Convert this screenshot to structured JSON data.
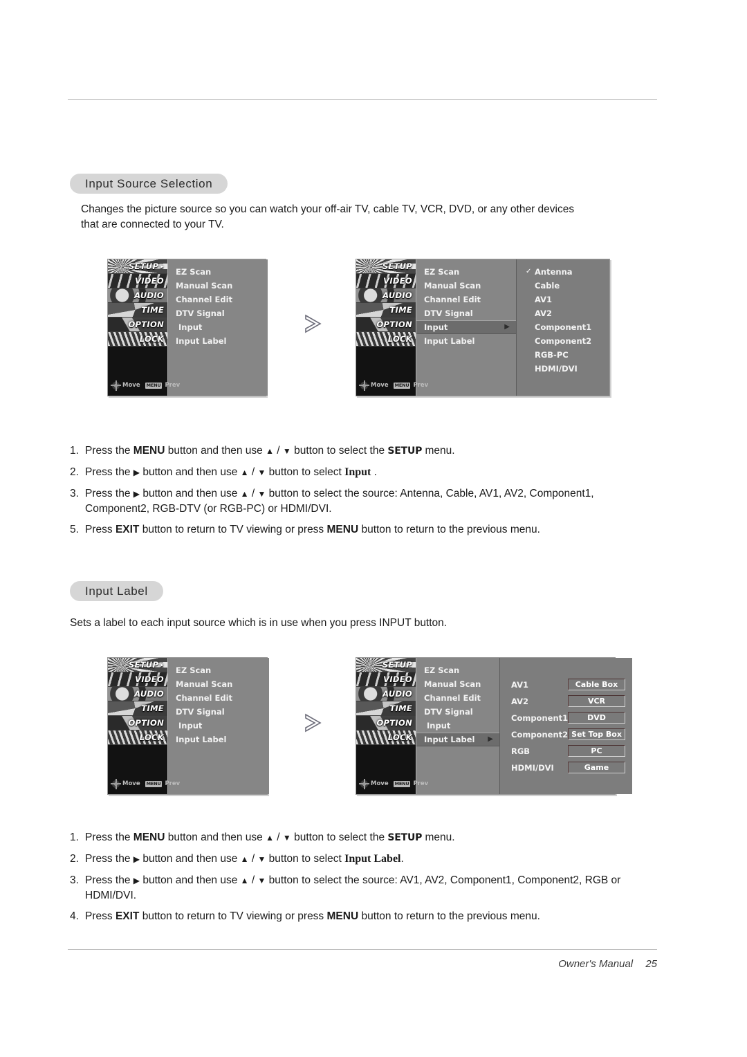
{
  "footer": {
    "manual_label": "Owner's Manual",
    "page_number": "25"
  },
  "sections": [
    {
      "badge": "Input Source Selection",
      "description": "Changes the picture source so you can watch your off-air TV, cable TV, VCR, DVD, or any other devices\nthat are connected to your TV."
    },
    {
      "badge": "Input Label",
      "description": "Sets a label to each input source which is in use when you press INPUT button."
    }
  ],
  "osd": {
    "sidebar": [
      {
        "label": "SETUP"
      },
      {
        "label": "VIDEO"
      },
      {
        "label": "AUDIO"
      },
      {
        "label": "TIME"
      },
      {
        "label": "OPTION"
      },
      {
        "label": "LOCK"
      }
    ],
    "footer": {
      "move_label": "Move",
      "menu_key": "MENU",
      "prev_label": "Prev"
    },
    "menu_items": [
      "EZ Scan",
      "Manual Scan",
      "Channel Edit",
      "DTV Signal",
      "Input",
      "Input Label"
    ],
    "input_sources": [
      "Antenna",
      "Cable",
      "AV1",
      "AV2",
      "Component1",
      "Component2",
      "RGB-PC",
      "HDMI/DVI"
    ],
    "selected_source": "Antenna",
    "input_labels": [
      {
        "source": "AV1",
        "value": "Cable Box"
      },
      {
        "source": "AV2",
        "value": "VCR"
      },
      {
        "source": "Component1",
        "value": "DVD"
      },
      {
        "source": "Component2",
        "value": "Set Top Box"
      },
      {
        "source": "RGB",
        "value": "PC"
      },
      {
        "source": "HDMI/DVI",
        "value": "Game"
      }
    ]
  },
  "steps_input_source": [
    {
      "num": "1.",
      "html": "Press the <b>MENU</b> button and then use <span class='glyph'>▲</span> / <span class='glyph'>▼</span> button to select the <span class='kbd-setup'>SETUP</span> menu."
    },
    {
      "num": "2.",
      "html": "Press the <span class='glyph'>▶</span> button and then use <span class='glyph'>▲</span> / <span class='glyph'>▼</span> button to select <span class='kbd-serif'>Input</span> ."
    },
    {
      "num": "3.",
      "html": "Press the <span class='glyph'>▶</span> button and then use <span class='glyph'>▲</span> / <span class='glyph'>▼</span> button to select the source: Antenna, Cable, AV1, AV2, Component1, Component2, RGB-DTV (or RGB-PC) or HDMI/DVI."
    },
    {
      "num": "5.",
      "html": "Press <b>EXIT</b> button to return to TV viewing or press <b>MENU</b> button to return to the previous menu."
    }
  ],
  "steps_input_label": [
    {
      "num": "1.",
      "html": "Press the <b>MENU</b> button and then use <span class='glyph'>▲</span> / <span class='glyph'>▼</span> button to select the <span class='kbd-setup'>SETUP</span> menu."
    },
    {
      "num": "2.",
      "html": "Press the <span class='glyph'>▶</span> button and then use <span class='glyph'>▲</span> / <span class='glyph'>▼</span> button to select <span class='kbd-serif'>Input Label</span>."
    },
    {
      "num": "3.",
      "html": "Press the <span class='glyph'>▶</span> button and then use <span class='glyph'>▲</span> / <span class='glyph'>▼</span> button to select the source: AV1, AV2, Component1, Component2, RGB or HDMI/DVI."
    },
    {
      "num": "4.",
      "html": "Press <b>EXIT</b> button to return to TV viewing or press <b>MENU</b> button to return to the previous menu."
    }
  ],
  "mockups": {
    "m1_highlight": null,
    "m2_highlight": "Input",
    "m3_highlight": null,
    "m4_highlight": "Input Label"
  }
}
